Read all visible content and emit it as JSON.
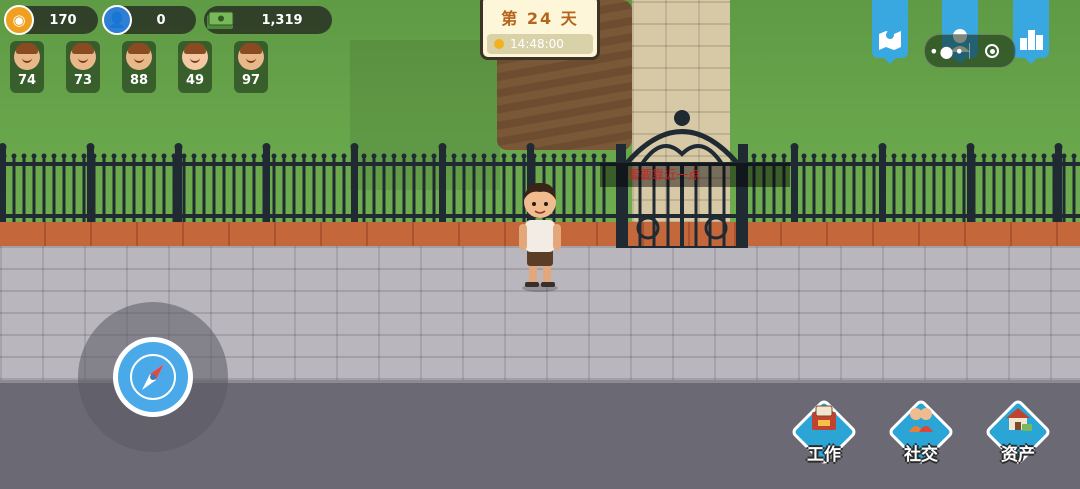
{
  "resources": {
    "coins": "170",
    "fans": "0",
    "cash": "1,319"
  },
  "stats": [
    {
      "icon": "hungry-face-icon",
      "value": "74"
    },
    {
      "icon": "tired-face-icon",
      "value": "73"
    },
    {
      "icon": "happy-face-icon",
      "value": "88"
    },
    {
      "icon": "calm-face-icon",
      "value": "49"
    },
    {
      "icon": "cheerful-face-icon",
      "value": "97"
    }
  ],
  "day": {
    "label": "第 24 天",
    "time": "14:48:00"
  },
  "gate_hint": "需要靠近一点",
  "top_right": {
    "menu": "•●•",
    "icons": [
      "map-icon",
      "profile-icon",
      "ranking-icon"
    ]
  },
  "actions": [
    {
      "label": "工作",
      "icon": "work-icon"
    },
    {
      "label": "社交",
      "icon": "social-icon"
    },
    {
      "label": "资产",
      "icon": "assets-icon"
    }
  ],
  "colors": {
    "grass": "#6aa14a",
    "accent_blue": "#39a7e0",
    "day_text": "#b5641c",
    "hint_text": "#d02020"
  }
}
